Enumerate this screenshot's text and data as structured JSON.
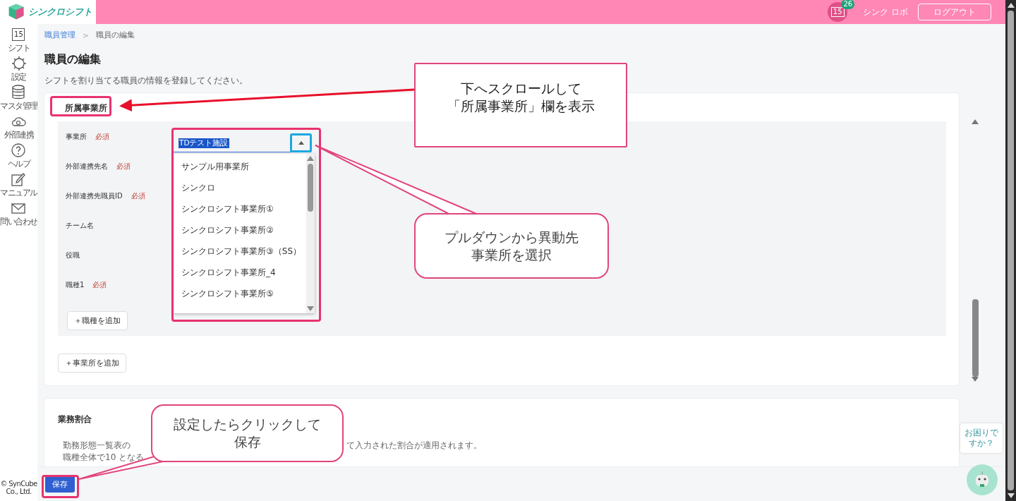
{
  "header": {
    "app_name": "シンクロシフト",
    "calendar_day": "15",
    "notification_count": "26",
    "user_name": "シンク ロボ",
    "logout": "ログアウト"
  },
  "sidebar": {
    "items": [
      {
        "label": "シフト",
        "day": "15"
      },
      {
        "label": "設定"
      },
      {
        "label": "マスタ管理"
      },
      {
        "label": "外部連携"
      },
      {
        "label": "ヘルプ"
      },
      {
        "label": "マニュアル"
      },
      {
        "label": "問い合わせ"
      }
    ],
    "copyright": "© SynCube Co., Ltd."
  },
  "breadcrumb": {
    "items": [
      {
        "label": "職員管理",
        "link": true
      },
      {
        "label": "職員の編集",
        "link": false
      }
    ],
    "separator": ">"
  },
  "page": {
    "title": "職員の編集",
    "description": "シフトを割り当てる職員の情報を登録してください。"
  },
  "office_section": {
    "title": "所属事業所",
    "fields": [
      {
        "label": "事業所",
        "required": "必須"
      },
      {
        "label": "外部連携先名",
        "required": "必須"
      },
      {
        "label": "外部連携先職員ID",
        "required": "必須"
      },
      {
        "label": "チーム名"
      },
      {
        "label": "役職"
      },
      {
        "label": "職種1",
        "required": "必須"
      }
    ],
    "office_select": {
      "value": "TDテスト施設",
      "expanded": true,
      "options": [
        "サンプル用事業所",
        "シンクロ",
        "シンクロシフト事業所①",
        "シンクロシフト事業所②",
        "シンクロシフト事業所③（SS）",
        "シンクロシフト事業所_4",
        "シンクロシフト事業所⑤"
      ]
    },
    "add_job_button": "＋職種を追加",
    "add_office_button": "＋事業所を追加"
  },
  "ratio_section": {
    "title": "業務割合",
    "lines": [
      [
        "勤務形態一覧表の",
        "て入力された割合が適用されます。"
      ],
      [
        "職種全体で10",
        "となる"
      ]
    ]
  },
  "save_button": "保存",
  "help_bubble": "お困りですか？",
  "annotations": [
    {
      "kind": "box",
      "lines": [
        "下へスクロールして",
        "「所属事業所」欄を表示"
      ]
    },
    {
      "kind": "bubble",
      "lines": [
        "プルダウンから異動先",
        "事業所を選択"
      ]
    },
    {
      "kind": "bubble",
      "lines": [
        "設定したらクリックして",
        "保存"
      ]
    }
  ]
}
